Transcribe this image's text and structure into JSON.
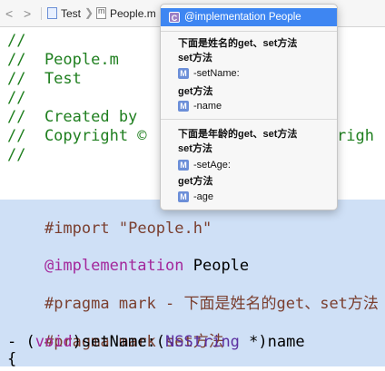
{
  "jumpbar": {
    "back_glyph": "<",
    "forward_glyph": ">",
    "project": "Test",
    "file": "People.m",
    "chevron": "❯"
  },
  "code": {
    "lines": [
      "//",
      "//  People.m",
      "//  Test",
      "//",
      "//  Created by",
      "//  Copyright ©",
      "//"
    ],
    "copyright_tail": "righ",
    "import_kw": "#import",
    "import_val": "\"People.h\"",
    "impl_kw": "@implementation",
    "impl_name": "People",
    "pragma1_kw": "#pragma mark",
    "pragma1_text": "- 下面是姓名的get、set方法",
    "pragma2_kw": "#pragma mark",
    "pragma2_text": "set方法",
    "method_dash": "- (",
    "method_void": "void",
    "method_mid": ")setName:(",
    "method_type": "NSString",
    "method_tail": " *)name",
    "brace": "{"
  },
  "popup": {
    "selected": {
      "badge": "C",
      "label": "@implementation People"
    },
    "group1_header": "下面是姓名的get、set方法",
    "group1_set_header": "set方法",
    "group1_set_item": {
      "badge": "M",
      "label": "-setName:"
    },
    "group1_get_header": "get方法",
    "group1_get_item": {
      "badge": "M",
      "label": "-name"
    },
    "group2_header": "下面是年龄的get、set方法",
    "group2_set_header": "set方法",
    "group2_set_item": {
      "badge": "M",
      "label": "-setAge:"
    },
    "group2_get_header": "get方法",
    "group2_get_item": {
      "badge": "M",
      "label": "-age"
    }
  },
  "colors": {
    "selection": "#cfe0f6",
    "comment": "#1f7f1f",
    "highlight": "#3e86f2"
  }
}
